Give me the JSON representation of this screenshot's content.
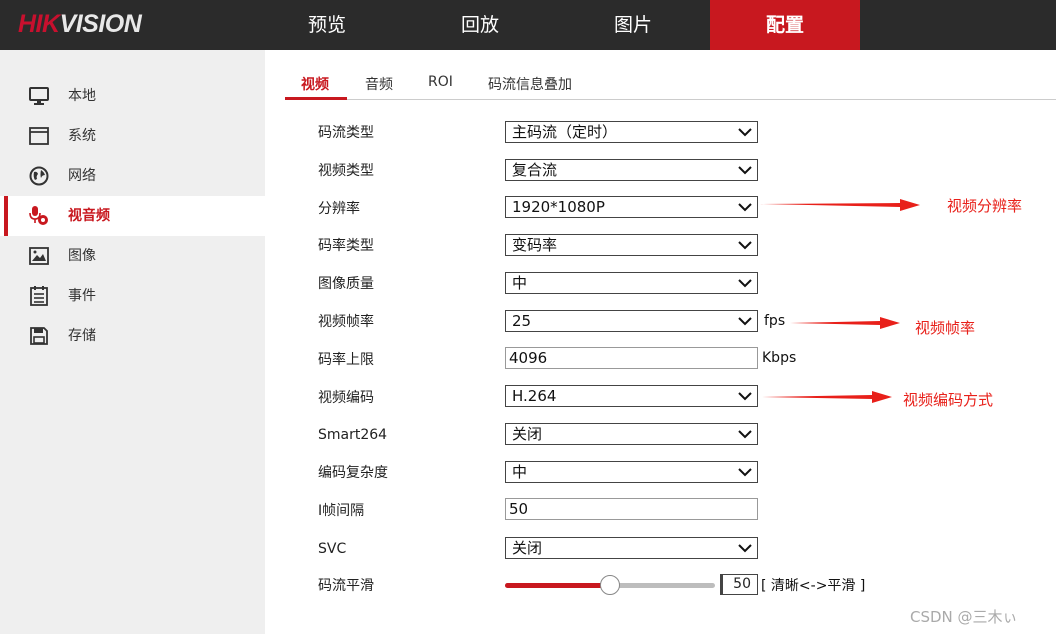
{
  "logo": {
    "part1": "HIK",
    "part2": "VISION"
  },
  "nav": [
    "预览",
    "回放",
    "图片",
    "配置"
  ],
  "sidebar": [
    "本地",
    "系统",
    "网络",
    "视音频",
    "图像",
    "事件",
    "存储"
  ],
  "tabs": [
    "视频",
    "音频",
    "ROI",
    "码流信息叠加"
  ],
  "form": {
    "stream_type": {
      "label": "码流类型",
      "value": "主码流（定时）"
    },
    "video_type": {
      "label": "视频类型",
      "value": "复合流"
    },
    "resolution": {
      "label": "分辨率",
      "value": "1920*1080P"
    },
    "bitrate_type": {
      "label": "码率类型",
      "value": "变码率"
    },
    "image_quality": {
      "label": "图像质量",
      "value": "中"
    },
    "frame_rate": {
      "label": "视频帧率",
      "value": "25",
      "unit": "fps"
    },
    "max_bitrate": {
      "label": "码率上限",
      "value": "4096",
      "unit": "Kbps"
    },
    "video_encoding": {
      "label": "视频编码",
      "value": "H.264"
    },
    "smart264": {
      "label": "Smart264",
      "value": "关闭"
    },
    "complexity": {
      "label": "编码复杂度",
      "value": "中"
    },
    "i_frame_interval": {
      "label": "I帧间隔",
      "value": "50"
    },
    "svc": {
      "label": "SVC",
      "value": "关闭"
    },
    "smoothing": {
      "label": "码流平滑",
      "value": "50",
      "unit": "[ 清晰<->平滑 ]",
      "percent": 50
    }
  },
  "annotations": {
    "resolution": "视频分辨率",
    "frame_rate": "视频帧率",
    "encoding": "视频编码方式"
  },
  "accent_color": "#c8181f",
  "annotation_color": "#e8201a",
  "watermark": "CSDN @三木ぃ"
}
